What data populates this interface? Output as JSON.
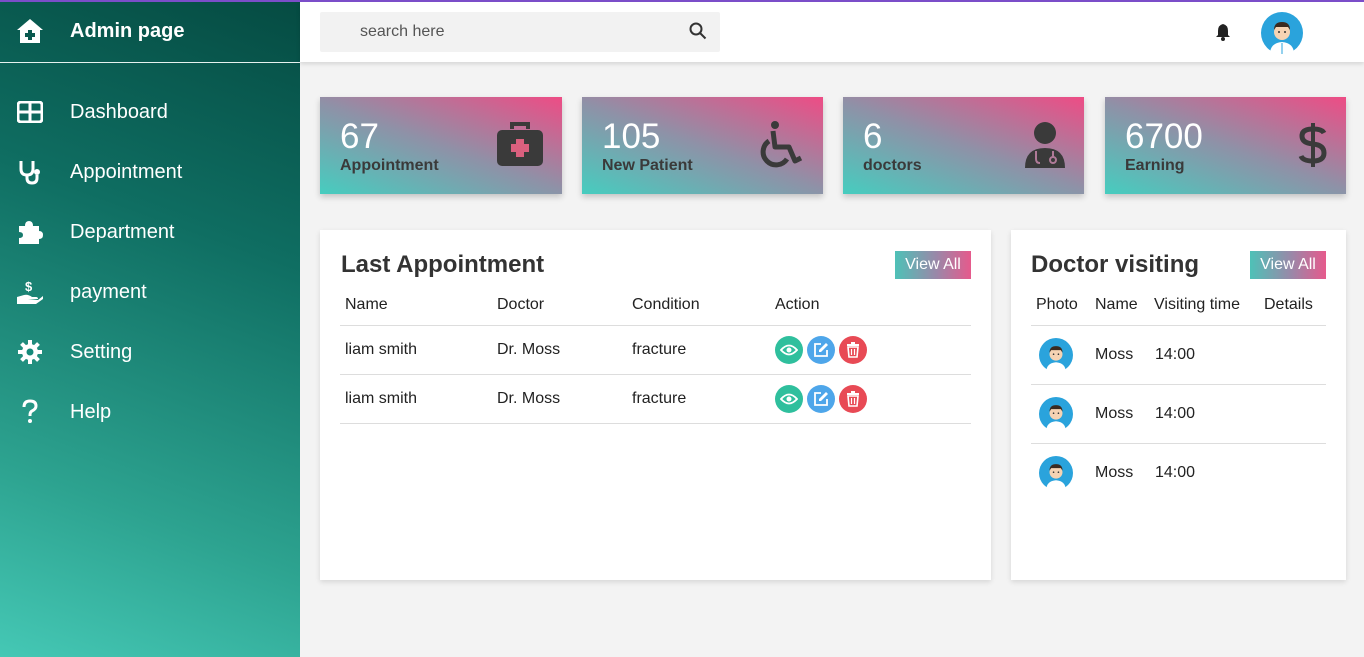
{
  "sidebar": {
    "title": "Admin page",
    "items": [
      {
        "label": "Dashboard",
        "icon": "dashboard-icon"
      },
      {
        "label": "Appointment",
        "icon": "stethoscope-icon"
      },
      {
        "label": "Department",
        "icon": "puzzle-icon"
      },
      {
        "label": "payment",
        "icon": "payment-hand-icon"
      },
      {
        "label": "Setting",
        "icon": "gear-icon"
      },
      {
        "label": "Help",
        "icon": "question-icon"
      }
    ]
  },
  "search": {
    "placeholder": "search here"
  },
  "cards": [
    {
      "value": "67",
      "label": "Appointment",
      "icon": "medkit-icon"
    },
    {
      "value": "105",
      "label": "New Patient",
      "icon": "wheelchair-icon"
    },
    {
      "value": "6",
      "label": "doctors",
      "icon": "doctor-icon"
    },
    {
      "value": "6700",
      "label": "Earning",
      "icon": "dollar-icon"
    }
  ],
  "appointments": {
    "title": "Last Appointment",
    "view_all": "View All",
    "columns": [
      "Name",
      "Doctor",
      "Condition",
      "Action"
    ],
    "rows": [
      {
        "name": "liam smith",
        "doctor": "Dr. Moss",
        "condition": "fracture"
      },
      {
        "name": "liam smith",
        "doctor": "Dr. Moss",
        "condition": "fracture"
      }
    ]
  },
  "visiting": {
    "title": "Doctor visiting",
    "view_all": "View All",
    "columns": [
      "Photo",
      "Name",
      "Visiting time",
      "Details"
    ],
    "rows": [
      {
        "name": "Moss",
        "time": "14:00"
      },
      {
        "name": "Moss",
        "time": "14:00"
      },
      {
        "name": "Moss",
        "time": "14:00"
      }
    ]
  },
  "colors": {
    "accent_gradient_start": "#46cdbf",
    "accent_gradient_end": "#ee4c85",
    "sidebar_dark": "#054b42",
    "sidebar_light": "#45c8b5"
  }
}
